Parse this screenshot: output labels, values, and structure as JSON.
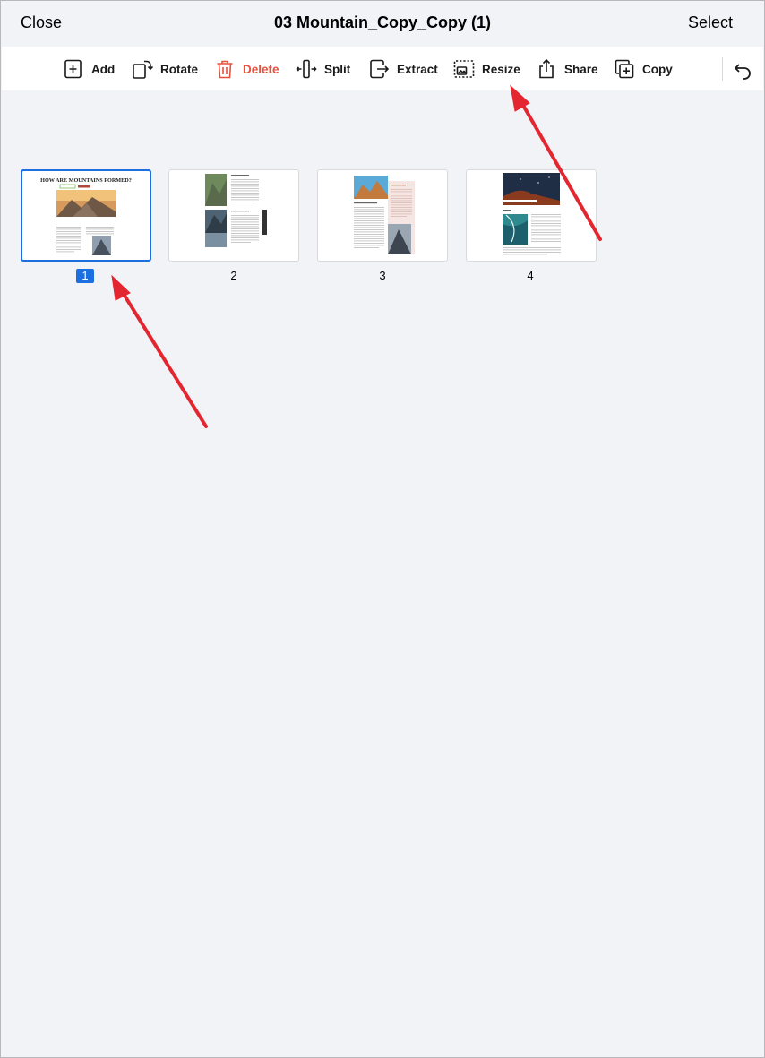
{
  "navbar": {
    "close_label": "Close",
    "title": "03 Mountain_Copy_Copy (1)",
    "select_label": "Select"
  },
  "toolbar": {
    "items": [
      {
        "label": "Add",
        "icon": "add-page-icon"
      },
      {
        "label": "Rotate",
        "icon": "rotate-icon"
      },
      {
        "label": "Delete",
        "icon": "trash-icon"
      },
      {
        "label": "Split",
        "icon": "split-icon"
      },
      {
        "label": "Extract",
        "icon": "extract-icon"
      },
      {
        "label": "Resize",
        "icon": "resize-icon"
      },
      {
        "label": "Share",
        "icon": "share-icon"
      },
      {
        "label": "Copy",
        "icon": "copy-icon"
      }
    ],
    "undo_icon": "undo-icon"
  },
  "pages": [
    {
      "number": "1",
      "selected": true,
      "heading": "HOW ARE MOUNTAINS FORMED?"
    },
    {
      "number": "2",
      "selected": false
    },
    {
      "number": "3",
      "selected": false
    },
    {
      "number": "4",
      "selected": false
    }
  ],
  "colors": {
    "accent": "#1b6fe0",
    "delete": "#e8503e",
    "annotation_arrow": "#e32630",
    "background": "#f2f3f7"
  }
}
